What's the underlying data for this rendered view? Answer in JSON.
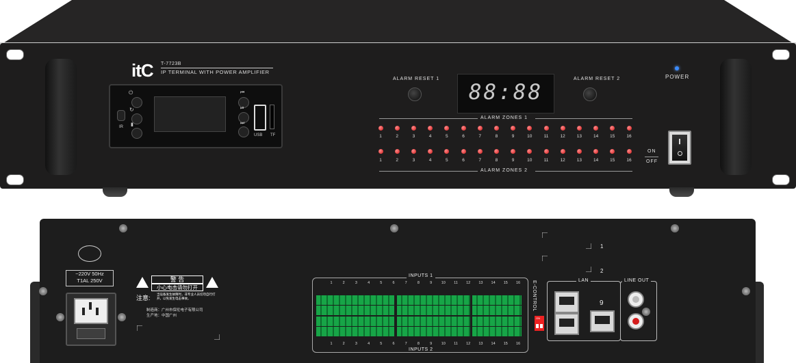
{
  "front": {
    "brand_logo": "itC",
    "model": "T-7723B",
    "subtitle": "IP TERMINAL WITH POWER AMPLIFIER",
    "media": {
      "ir_label": "IR",
      "usb_label": "USB",
      "tf_label": "TF"
    },
    "alarm_reset_1": "ALARM RESET 1",
    "alarm_reset_2": "ALARM RESET 2",
    "clock": "88:88",
    "zones_1_label": "ALARM ZONES 1",
    "zones_2_label": "ALARM ZONES 2",
    "zone_numbers": [
      "1",
      "2",
      "3",
      "4",
      "5",
      "6",
      "7",
      "8",
      "9",
      "10",
      "11",
      "12",
      "13",
      "14",
      "15",
      "16"
    ],
    "power_label": "POWER",
    "on_label": "ON",
    "off_label": "OFF",
    "colors": {
      "led_red": "#d01818",
      "power_blue": "#3a8bff"
    }
  },
  "rear": {
    "fuse_line1": "~220V  50Hz",
    "fuse_line2": "T1AL  250V",
    "warning_title": "警  告",
    "warning_line1": "小心电击请勿打开",
    "caution": "注意:",
    "caution_text": "当设备发生故障时，非专业人员切勿自行打开，以免发生电击事故。",
    "manufacturer": "制造商：广州市保伦电子有限公司",
    "origin": "生产地：中国广州",
    "inputs_1_label": "INPUTS 1",
    "inputs_2_label": "INPUTS 2",
    "input_numbers": [
      "1",
      "2",
      "3",
      "4",
      "5",
      "6",
      "7",
      "8",
      "9",
      "10",
      "11",
      "12",
      "13",
      "14",
      "15",
      "16"
    ],
    "econtrol_label": "E-CONTROL",
    "lan_label": "LAN",
    "lineout_label": "LINE OUT",
    "port_9": "9",
    "marker_1": "1",
    "marker_2": "2",
    "dip_on": "ON"
  }
}
